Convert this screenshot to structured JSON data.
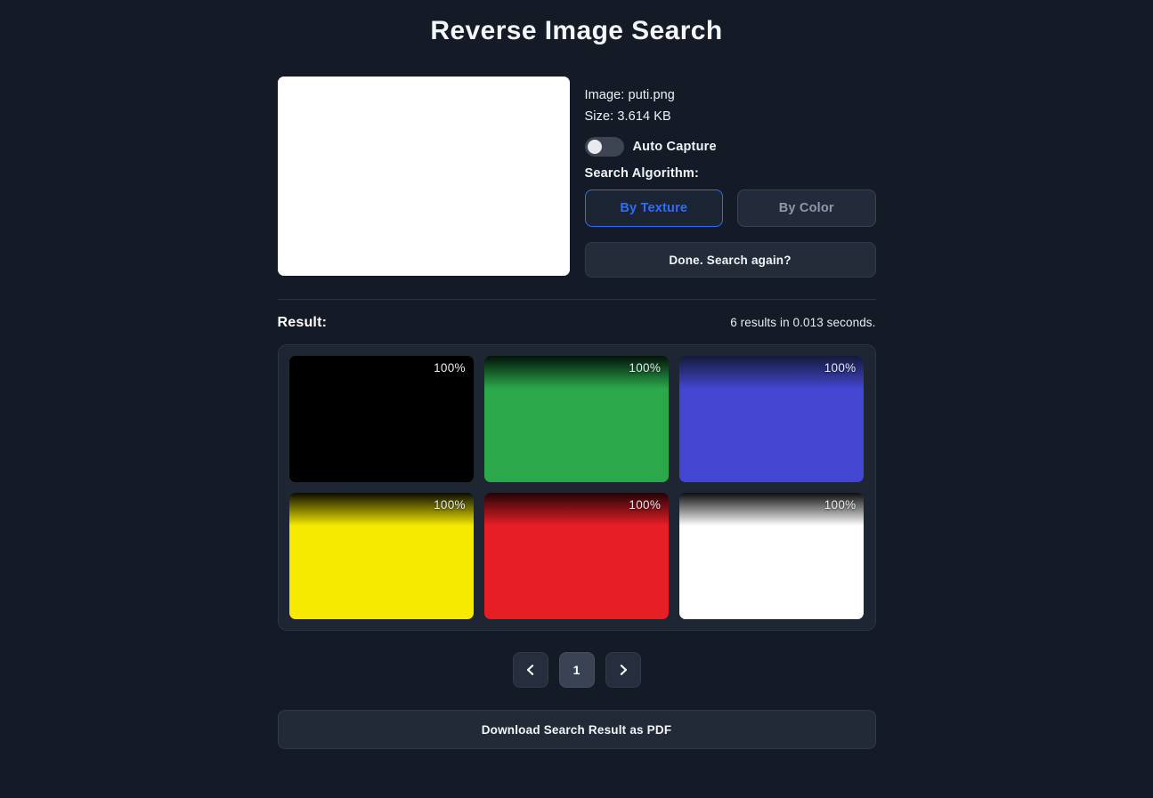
{
  "header": {
    "title": "Reverse Image Search"
  },
  "upload": {
    "image_line": "Image: puti.png",
    "size_line": "Size: 3.614 KB",
    "preview_color": "#ffffff"
  },
  "auto_capture": {
    "label": "Auto Capture",
    "state": "off"
  },
  "algorithm": {
    "label": "Search Algorithm:",
    "options": [
      {
        "label": "By Texture",
        "selected": true
      },
      {
        "label": "By Color",
        "selected": false
      }
    ],
    "accent": "#2f6df6"
  },
  "search_again": {
    "label": "Done. Search again?"
  },
  "result": {
    "label": "Result:",
    "stats": "6 results in 0.013 seconds.",
    "tiles": [
      {
        "pct": "100%",
        "top_color": "#000000",
        "bottom_color": "#000000",
        "stop": "100%"
      },
      {
        "pct": "100%",
        "top_color": "#02120a",
        "bottom_color": "#2aa84a",
        "stop": "26%"
      },
      {
        "pct": "100%",
        "top_color": "#131a3a",
        "bottom_color": "#4346d0",
        "stop": "26%"
      },
      {
        "pct": "100%",
        "top_color": "#0b0a00",
        "bottom_color": "#f5ea00",
        "stop": "26%"
      },
      {
        "pct": "100%",
        "top_color": "#230306",
        "bottom_color": "#e81e26",
        "stop": "26%"
      },
      {
        "pct": "100%",
        "top_color": "#0d0d0d",
        "bottom_color": "#ffffff",
        "stop": "26%"
      }
    ]
  },
  "pagination": {
    "prev_icon": "chevron-left-icon",
    "next_icon": "chevron-right-icon",
    "pages": [
      "1"
    ],
    "current": "1"
  },
  "download": {
    "label": "Download Search Result as PDF"
  }
}
